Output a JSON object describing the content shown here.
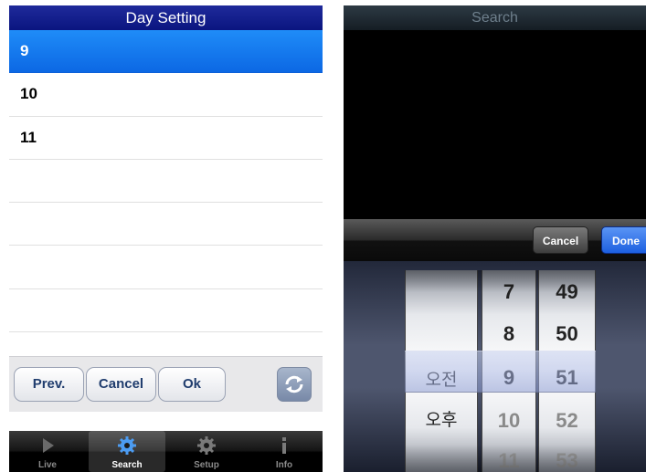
{
  "day_setting": {
    "title": "Day Setting",
    "items": [
      "9",
      "10",
      "11"
    ],
    "selected_index": 0,
    "buttons": {
      "prev": "Prev.",
      "cancel": "Cancel",
      "ok": "Ok"
    },
    "refresh_icon": "refresh-icon",
    "tabs": [
      {
        "label": "Live",
        "icon": "play-icon"
      },
      {
        "label": "Search",
        "icon": "gear-icon"
      },
      {
        "label": "Setup",
        "icon": "gear-icon"
      },
      {
        "label": "Info",
        "icon": "info-icon"
      }
    ],
    "active_tab": 1,
    "colors": {
      "title_bar": "#0a1580",
      "selected_row": "#0c68e4"
    }
  },
  "search": {
    "title": "Search",
    "toolbar": {
      "cancel": "Cancel",
      "done": "Done"
    },
    "picker": {
      "ampm": {
        "items": [
          "오전",
          "오후"
        ],
        "selected": "오전"
      },
      "hours": {
        "items": [
          "7",
          "8",
          "9",
          "10",
          "11"
        ],
        "selected": "9"
      },
      "minutes": {
        "items": [
          "49",
          "50",
          "51",
          "52",
          "53"
        ],
        "selected": "51"
      }
    },
    "colors": {
      "done_button": "#1d5fe0"
    }
  }
}
